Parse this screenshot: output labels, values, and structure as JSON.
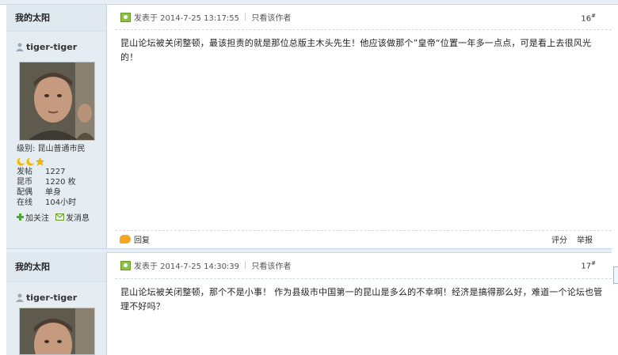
{
  "posts": [
    {
      "section_label": "我的太阳",
      "author": "tiger-tiger",
      "level_label": "级别:",
      "level_value": "昆山普通市民",
      "stats": [
        {
          "k": "发帖",
          "v": "1227"
        },
        {
          "k": "昆币",
          "v": "1220 枚"
        },
        {
          "k": "配偶",
          "v": "单身"
        },
        {
          "k": "在线",
          "v": "104小时"
        }
      ],
      "follow_label": "加关注",
      "message_label": "发消息",
      "posted_at": "发表于 2014-7-25 13:17:55",
      "author_only": "只看该作者",
      "floor": "16",
      "floor_sup": "#",
      "content": "昆山论坛被关闭整顿，最该担责的就是那位总版主木头先生！他应该做那个”皇帝“位置一年多一点点，可是看上去很风光的！",
      "reply_label": "回复",
      "rate_label": "评分",
      "report_label": "举报"
    },
    {
      "section_label": "我的太阳",
      "author": "tiger-tiger",
      "posted_at": "发表于 2014-7-25 14:30:39",
      "author_only": "只看该作者",
      "floor": "17",
      "floor_sup": "#",
      "content": "昆山论坛被关闭整顿，那个不是小事！ 作为县级市中国第一的昆山是多么的不幸啊！经济是搞得那么好，难道一个论坛也管理不好吗？"
    }
  ],
  "colors": {
    "sidebar_bg": "#e5edf2",
    "online_icon": "#8fc244",
    "reply_icon": "#f5a623",
    "badge_moon": "#f5b800"
  }
}
